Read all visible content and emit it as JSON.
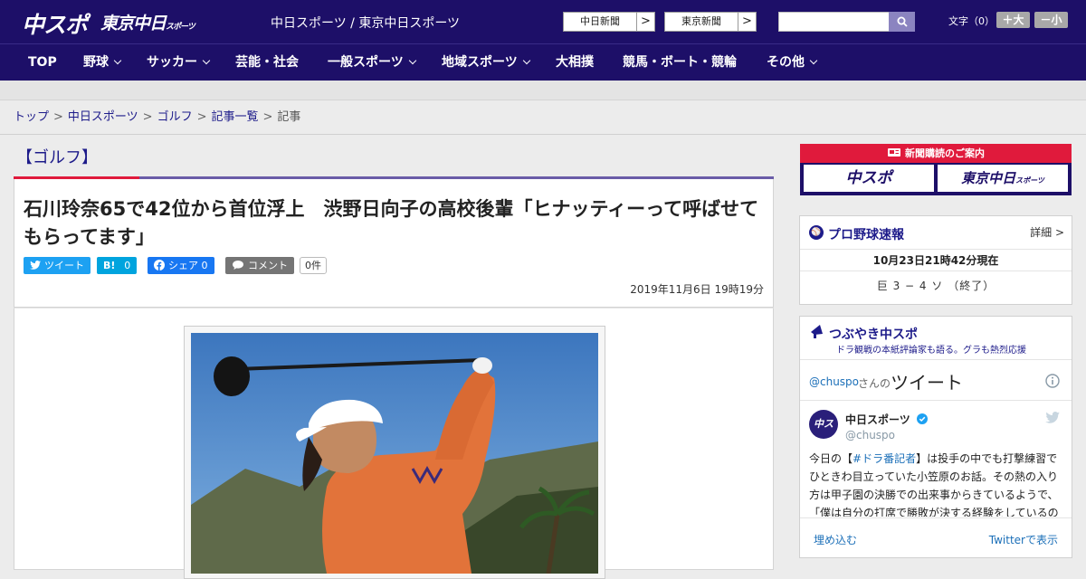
{
  "header": {
    "logo_chuspo": "中スポ",
    "logo_tokyo": "東京中日",
    "logo_tokyo_small": "スポーツ",
    "site_name": "中日スポーツ / 東京中日スポーツ",
    "paper_links": [
      {
        "label": "中日新聞",
        "arrow": ">"
      },
      {
        "label": "東京新聞",
        "arrow": ">"
      }
    ],
    "search": {
      "placeholder": ""
    },
    "font_size_label": "文字（0）",
    "font_larger": "＋大",
    "font_smaller": "－小"
  },
  "nav": {
    "items": [
      {
        "label": "TOP"
      },
      {
        "label": "野球"
      },
      {
        "label": "サッカー"
      },
      {
        "label": "芸能・社会"
      },
      {
        "label": "一般スポーツ"
      },
      {
        "label": "地域スポーツ"
      },
      {
        "label": "大相撲"
      },
      {
        "label": "競馬・ボート・競輪"
      },
      {
        "label": "その他"
      }
    ]
  },
  "breadcrumb": {
    "items": [
      "トップ",
      "中日スポーツ",
      "ゴルフ",
      "記事一覧"
    ],
    "current": "記事",
    "separator": ">"
  },
  "article": {
    "section": "【ゴルフ】",
    "headline": "石川玲奈65で42位から首位浮上　渋野日向子の高校後輩「ヒナッティーって呼ばせてもらってます」",
    "share": {
      "tweet": "ツイート",
      "hatena_icon": "B!",
      "hatena_count": "0",
      "facebook": "シェア 0",
      "comment": "コメント",
      "comment_count": "0件"
    },
    "date": "2019年11月6日 19時19分"
  },
  "sidebar": {
    "subscribe": {
      "title": "新聞購読のご案内",
      "chuspo": "中スポ",
      "tokyo": "東京中日",
      "tokyo_small": "スポーツ"
    },
    "baseball": {
      "title": "プロ野球速報",
      "detail": "詳細 >",
      "updated": "10月23日21時42分現在",
      "score": "巨 3 − 4 ソ （終了）"
    },
    "twitter": {
      "title": "つぶやき中スポ",
      "subtitle": "ドラ観戦の本紙評論家も語る。グラも熱烈応援",
      "handle": "@chuspo",
      "san_no": "さんの",
      "tweets_label": "ツイート",
      "account_name": "中日スポーツ",
      "account_handle": "@chuspo",
      "avatar_text": "中スポ",
      "tweet_text_1": "今日の【",
      "tweet_hashtag": "#ドラ番記者",
      "tweet_text_2": "】は投手の中でも打撃練習でひときわ目立っていた小笠原のお話。その熱の入り方は甲子園の決勝での出来事からきているようで、「僕は自分の打席で勝敗が決する経験をしているの",
      "embed": "埋め込む",
      "view_on_twitter": "Twitterで表示"
    }
  },
  "colors": {
    "brand_navy": "#1d0f68",
    "accent_red": "#e01a3c",
    "twitter_blue": "#1da1f2",
    "facebook_blue": "#1877f2",
    "hatena_blue": "#00a4de"
  }
}
